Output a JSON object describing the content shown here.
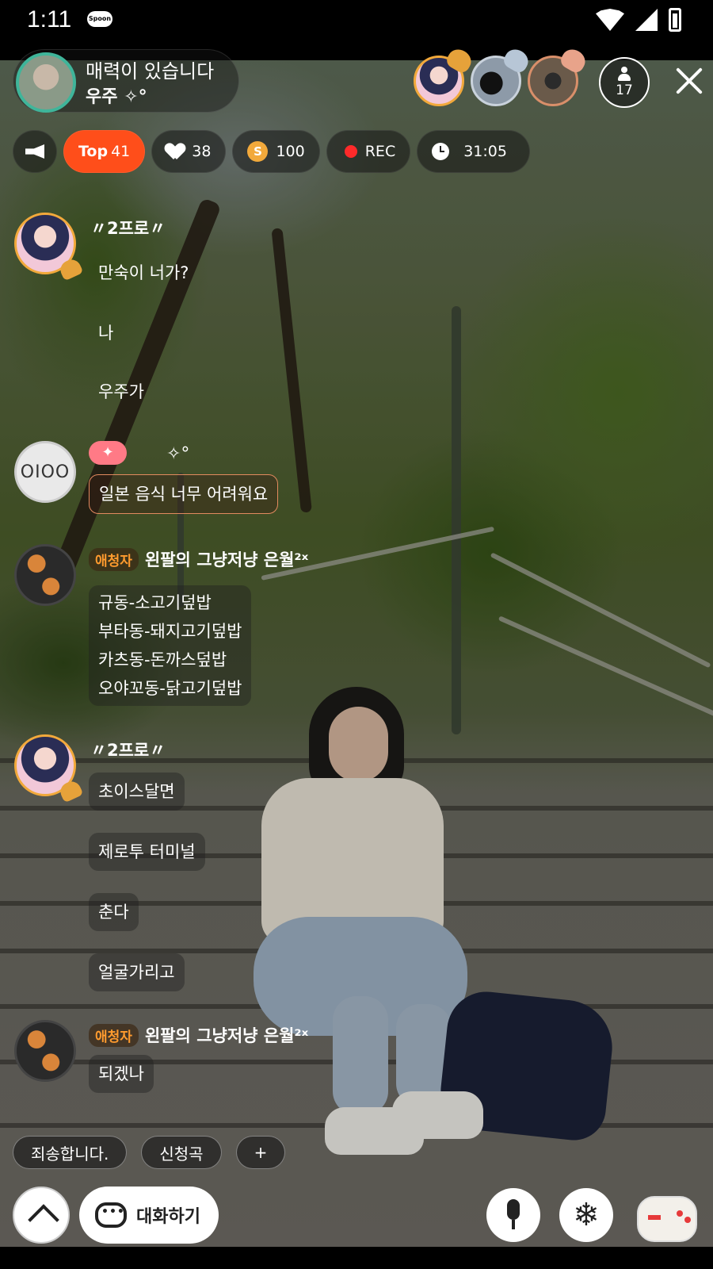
{
  "status_bar": {
    "time": "1:11",
    "app_badge": "Spoon"
  },
  "host": {
    "title": "매력이 있습니다",
    "name": "우주 ✧°"
  },
  "viewers": {
    "count": "17"
  },
  "stats": {
    "top_label": "Top",
    "top_value": "41",
    "likes": "38",
    "spoons": "100",
    "rec_label": "REC",
    "elapsed": "31:05"
  },
  "chat": [
    {
      "nick": "〃2프로〃",
      "lines": [
        "만숙이 너가?",
        "나",
        "우주가"
      ]
    },
    {
      "avatar_text": "OIOO",
      "sparkle": "✦",
      "sparkle2": "✧°",
      "text": "일본 음식 너무 어려워요"
    },
    {
      "role": "애청자",
      "nick": "왼팔의 그냥저냥 은월²ˣ",
      "lines": [
        "규동-소고기덮밥",
        "부타동-돼지고기덮밥",
        "카츠동-돈까스덮밥",
        "오야꼬동-닭고기덮밥"
      ]
    },
    {
      "nick": "〃2프로〃",
      "lines": [
        "초이스달면",
        "제로투 터미널",
        "춘다",
        "얼굴가리고"
      ]
    },
    {
      "role": "애청자",
      "nick": "왼팔의 그냥저냥 은월²ˣ",
      "lines": [
        "되겠나"
      ]
    }
  ],
  "quick_replies": [
    "죄송합니다.",
    "신청곡",
    "+"
  ],
  "bottom": {
    "chat_label": "대화하기",
    "snow_glyph": "❄"
  },
  "colors": {
    "accent_orange": "#ff4e1a",
    "gold": "#f2a93b",
    "host_ring": "#3fb59a"
  }
}
